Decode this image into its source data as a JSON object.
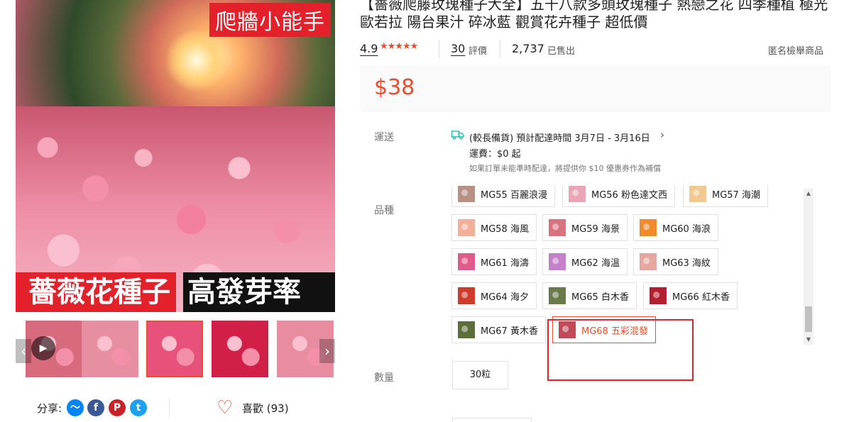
{
  "gallery": {
    "promo_tag": "爬牆小能手",
    "banner_left": "薔薇花種子",
    "banner_right": "高發芽率",
    "prev_icon": "chevron-left-icon",
    "next_icon": "chevron-right-icon",
    "play_icon": "play-icon",
    "thumbnails": [
      {
        "color": "#d86a7e"
      },
      {
        "color": "#e68fa0"
      },
      {
        "color": "#e7517a",
        "selected": true
      },
      {
        "color": "#d21f48"
      },
      {
        "color": "#e88ca0"
      }
    ]
  },
  "share": {
    "label": "分享:",
    "icons": [
      {
        "name": "messenger-icon",
        "color": "#0084ff",
        "glyph": "〜"
      },
      {
        "name": "facebook-icon",
        "color": "#3b5998",
        "glyph": "f"
      },
      {
        "name": "pinterest-icon",
        "color": "#cb2027",
        "glyph": "P"
      },
      {
        "name": "twitter-icon",
        "color": "#1da1f2",
        "glyph": "t"
      }
    ],
    "like_label": "喜歡 (93)"
  },
  "product": {
    "title": "【薔薇爬藤玫瑰種子大全】五十八款多頭玫瑰種子 熱戀之花 四季種植 極光歐若拉 陽台果汁 碎冰藍 觀賞花卉種子 超低價",
    "rating": "4.9",
    "stars": "★★★★★",
    "review_count": "30",
    "review_label": "評價",
    "sold_count": "2,737",
    "sold_label": "已售出",
    "report_label": "匿名檢舉商品",
    "price": "$38",
    "accent": "#ee4d2d"
  },
  "shipping": {
    "label": "運送",
    "icon": "truck-icon",
    "text": "(較長備貨) 預計配達時間 3月7日 - 3月16日",
    "fee": "運費：$0 起",
    "note": "如果訂單未能準時配達，將提供你 $10 優惠券作為補償"
  },
  "variant": {
    "label": "品種",
    "options": [
      {
        "label": "MG55 百麗浪漫",
        "color": "#b79184"
      },
      {
        "label": "MG56 粉色達文西",
        "color": "#e8a6b6"
      },
      {
        "label": "MG57 海潮",
        "color": "#f0c890"
      },
      {
        "label": "MG58 海風",
        "color": "#f2b09a"
      },
      {
        "label": "MG59 海景",
        "color": "#d9727f"
      },
      {
        "label": "MG60 海浪",
        "color": "#f28a2a"
      },
      {
        "label": "MG61 海濤",
        "color": "#e05a8a"
      },
      {
        "label": "MG62 海溫",
        "color": "#c480c8"
      },
      {
        "label": "MG63 海紋",
        "color": "#e6a7a0"
      },
      {
        "label": "MG64 海夕",
        "color": "#d03a2a"
      },
      {
        "label": "MG65 白木香",
        "color": "#6a7a4a"
      },
      {
        "label": "MG66 紅木香",
        "color": "#b41e2e"
      },
      {
        "label": "MG67 黃木香",
        "color": "#5e6e3a"
      },
      {
        "label": "MG68 五彩混發",
        "color": "#c04a5a",
        "selected": true
      }
    ]
  },
  "quantity": {
    "label": "數量",
    "value": "30粒"
  }
}
